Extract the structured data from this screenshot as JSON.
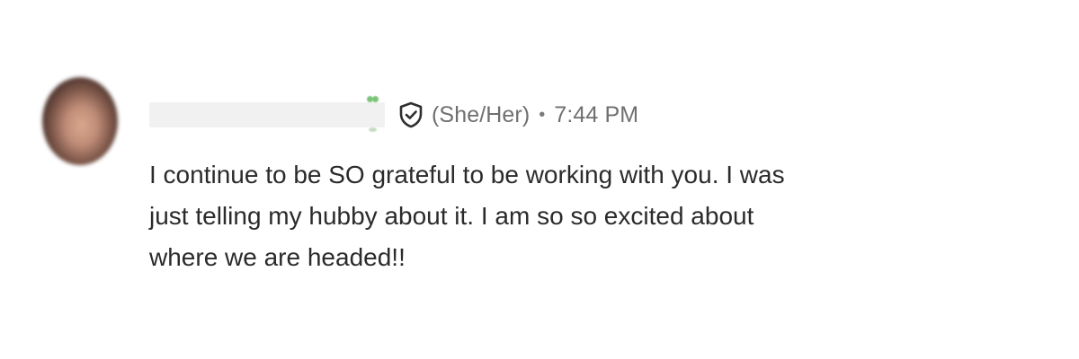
{
  "message": {
    "pronouns": "(She/Her)",
    "separator": "•",
    "time": "7:44 PM",
    "text_lines": [
      "I continue to be SO grateful to be working with you. I was",
      "just telling my hubby about it. I am so so excited about",
      "where we are headed!!"
    ],
    "icons": {
      "verified": "shield-check-icon"
    }
  }
}
